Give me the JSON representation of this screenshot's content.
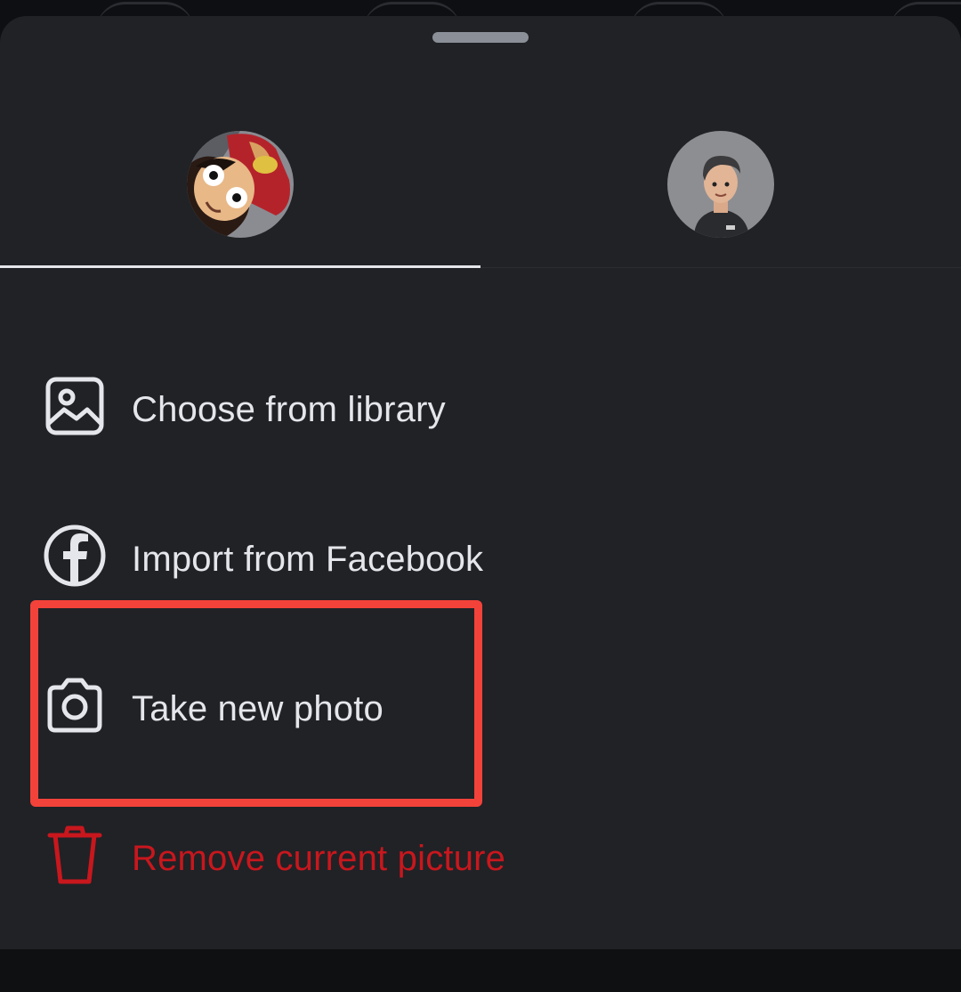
{
  "sheet": {
    "tabs": [
      {
        "name": "account-1",
        "avatar": "anime-character-avatar",
        "selected": true
      },
      {
        "name": "account-2",
        "avatar": "3d-cartoon-man-avatar",
        "selected": false
      }
    ]
  },
  "menu": {
    "choose_library": {
      "label": "Choose from library",
      "icon": "image-icon"
    },
    "import_facebook": {
      "label": "Import from Facebook",
      "icon": "facebook-icon"
    },
    "take_photo": {
      "label": "Take new photo",
      "icon": "camera-icon"
    },
    "remove_picture": {
      "label": "Remove current picture",
      "icon": "trash-icon"
    }
  },
  "colors": {
    "sheet_bg": "#202226",
    "text": "#e4e6eb",
    "danger": "#c8171d",
    "highlight": "#f3423a"
  }
}
